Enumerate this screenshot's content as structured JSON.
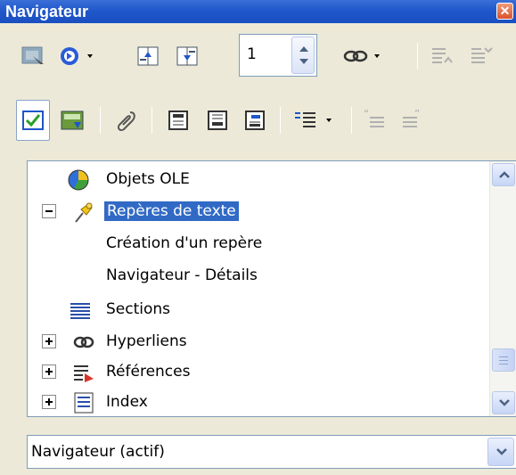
{
  "window": {
    "title": "Navigateur"
  },
  "toolbar": {
    "page_number": "1"
  },
  "tree": {
    "items": [
      {
        "label": "Objets OLE",
        "icon": "ole-objects-icon"
      },
      {
        "label": "Repères de texte",
        "icon": "bookmark-pin-icon",
        "selected": true,
        "expanded": true
      },
      {
        "label": "Création d'un repère"
      },
      {
        "label": "Navigateur - Détails"
      },
      {
        "label": "Sections",
        "icon": "sections-icon"
      },
      {
        "label": "Hyperliens",
        "icon": "hyperlink-icon"
      },
      {
        "label": "Références",
        "icon": "references-icon"
      },
      {
        "label": "Index",
        "icon": "index-icon"
      }
    ]
  },
  "document_selector": {
    "value": "Navigateur (actif)"
  },
  "colors": {
    "title_bar": "#1f56c9",
    "selection": "#316ac5",
    "window_bg": "#ece9d8"
  }
}
